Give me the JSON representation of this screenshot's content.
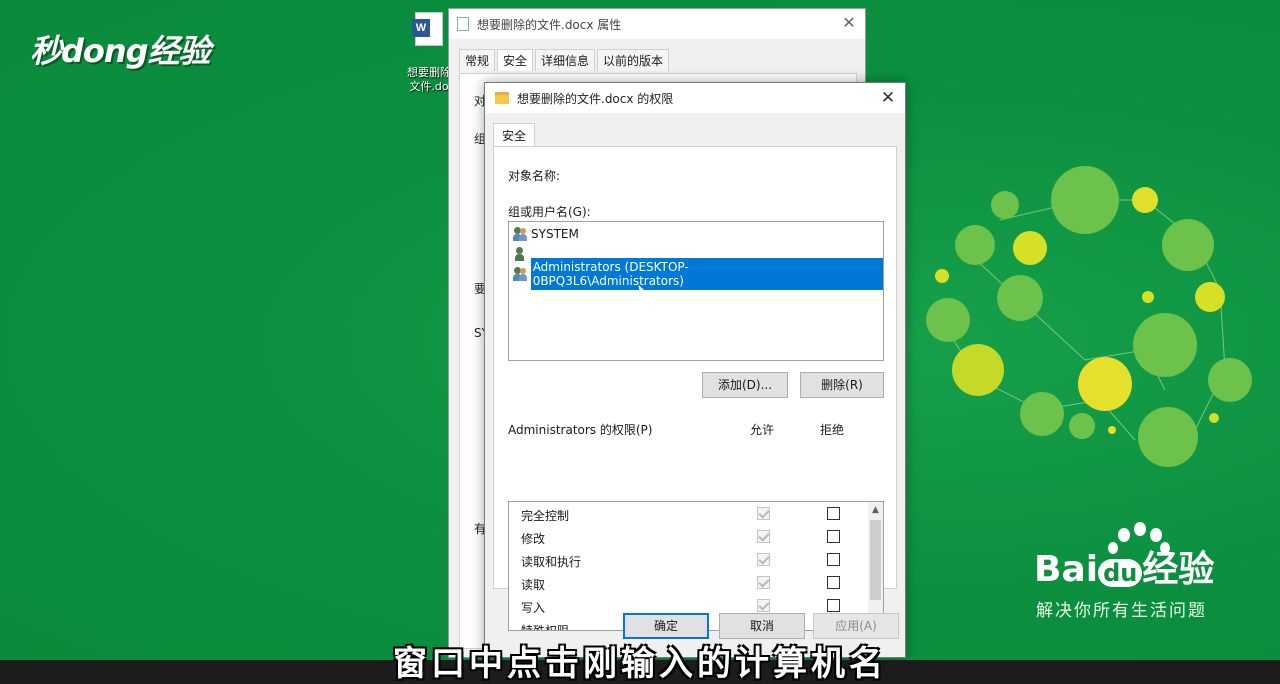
{
  "watermark": {
    "brand": "秒dong经验"
  },
  "desktop": {
    "icon_label_line1": "想要删除",
    "icon_label_line2": "文件.do",
    "icon_badge": "W"
  },
  "properties_window": {
    "title": "想要删除的文件.docx 属性",
    "close_glyph": "✕",
    "tabs": [
      {
        "label": "常规",
        "active": false
      },
      {
        "label": "安全",
        "active": true
      },
      {
        "label": "详细信息",
        "active": false
      },
      {
        "label": "以前的版本",
        "active": false
      }
    ],
    "fragments": [
      "对",
      "组",
      "要",
      "SY",
      "有"
    ]
  },
  "permissions_dialog": {
    "title": "想要删除的文件.docx 的权限",
    "close_glyph": "✕",
    "tab": "安全",
    "object_name_label": "对象名称:",
    "group_label": "组或用户名(G):",
    "users": [
      {
        "name": "SYSTEM",
        "selected": false
      },
      {
        "name": "",
        "selected": false
      },
      {
        "name": "Administrators (DESKTOP-0BPQ3L6\\Administrators)",
        "selected": true
      }
    ],
    "add_button": "添加(D)...",
    "remove_button": "删除(R)",
    "perm_label": "Administrators 的权限(P)",
    "allow_header": "允许",
    "deny_header": "拒绝",
    "permissions": [
      {
        "name": "完全控制",
        "allow": true,
        "deny": false
      },
      {
        "name": "修改",
        "allow": true,
        "deny": false
      },
      {
        "name": "读取和执行",
        "allow": true,
        "deny": false
      },
      {
        "name": "读取",
        "allow": true,
        "deny": false
      },
      {
        "name": "写入",
        "allow": true,
        "deny": false
      },
      {
        "name": "特殊权限",
        "allow": false,
        "deny": false
      }
    ],
    "ok_button": "确定",
    "cancel_button": "取消",
    "apply_button": "应用(A)"
  },
  "baidu": {
    "logo_left": "Bai",
    "logo_mid": "du",
    "logo_right": "经验",
    "slogan": "解决你所有生活问题"
  },
  "subtitle": "窗口中点击刚输入的计算机名",
  "colors": {
    "background": "#0b8f3f",
    "selection": "#0078d7"
  }
}
